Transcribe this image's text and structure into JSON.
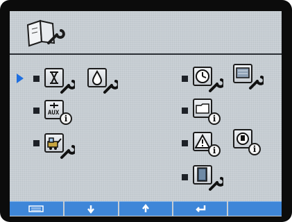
{
  "header": {
    "icon": "book-wrench-icon"
  },
  "menu": {
    "selected": "hourglass-wrench",
    "left": [
      {
        "id": "hourglass-wrench",
        "icons": [
          "hourglass-icon",
          "droplet-icon"
        ]
      },
      {
        "id": "aux-info",
        "icons": [
          "aux-icon"
        ],
        "aux_label": "AUX"
      },
      {
        "id": "machine-wrench",
        "icons": [
          "machine-icon"
        ]
      }
    ],
    "right": [
      {
        "id": "clock-wrench",
        "icons": [
          "clock-icon",
          "display-icon"
        ]
      },
      {
        "id": "folder-info",
        "icons": [
          "folder-icon"
        ]
      },
      {
        "id": "warning-info",
        "icons": [
          "warning-icon",
          "stop-icon"
        ]
      },
      {
        "id": "door-wrench",
        "icons": [
          "door-icon"
        ]
      }
    ]
  },
  "softkeys": [
    {
      "icon": "keyboard-icon"
    },
    {
      "icon": "arrow-down-icon"
    },
    {
      "icon": "arrow-up-icon"
    },
    {
      "icon": "enter-icon"
    },
    {
      "icon": "blank"
    }
  ],
  "colors": {
    "screen": "#c6cdd3",
    "softkey": "#3e86d8",
    "cursor": "#1f6fe0"
  }
}
